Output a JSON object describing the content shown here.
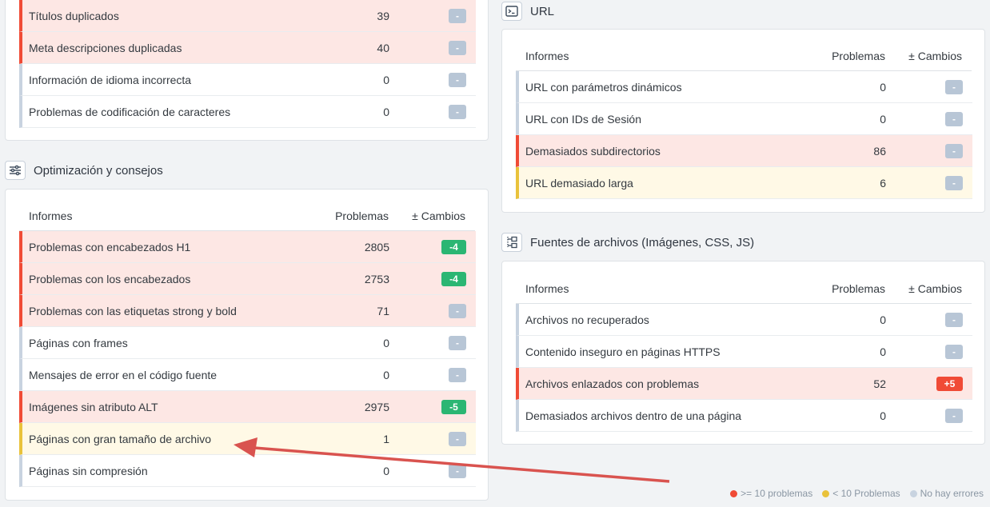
{
  "headers": {
    "reports": "Informes",
    "problems": "Problemas",
    "changes": "± Cambios"
  },
  "top_left_rows": [
    {
      "name": "Títulos duplicados",
      "count": "39",
      "change": "-",
      "level": "red",
      "badge": "neutral"
    },
    {
      "name": "Meta descripciones duplicadas",
      "count": "40",
      "change": "-",
      "level": "red",
      "badge": "neutral"
    },
    {
      "name": "Información de idioma incorrecta",
      "count": "0",
      "change": "-",
      "level": "none",
      "badge": "neutral"
    },
    {
      "name": "Problemas de codificación de caracteres",
      "count": "0",
      "change": "-",
      "level": "none",
      "badge": "neutral"
    }
  ],
  "optimization": {
    "title": "Optimización y consejos",
    "icon": "sliders-icon",
    "rows": [
      {
        "name": "Problemas con encabezados H1",
        "count": "2805",
        "change": "-4",
        "level": "red",
        "badge": "green"
      },
      {
        "name": "Problemas con los encabezados",
        "count": "2753",
        "change": "-4",
        "level": "red",
        "badge": "green"
      },
      {
        "name": "Problemas con las etiquetas strong y bold",
        "count": "71",
        "change": "-",
        "level": "red",
        "badge": "neutral"
      },
      {
        "name": "Páginas con frames",
        "count": "0",
        "change": "-",
        "level": "none",
        "badge": "neutral"
      },
      {
        "name": "Mensajes de error en el código fuente",
        "count": "0",
        "change": "-",
        "level": "none",
        "badge": "neutral"
      },
      {
        "name": "Imágenes sin atributo ALT",
        "count": "2975",
        "change": "-5",
        "level": "red",
        "badge": "green"
      },
      {
        "name": "Páginas con gran tamaño de archivo",
        "count": "1",
        "change": "-",
        "level": "yellow",
        "badge": "neutral"
      },
      {
        "name": "Páginas sin compresión",
        "count": "0",
        "change": "-",
        "level": "none",
        "badge": "neutral"
      }
    ]
  },
  "url": {
    "title": "URL",
    "icon": "terminal-icon",
    "rows": [
      {
        "name": "URL con parámetros dinámicos",
        "count": "0",
        "change": "-",
        "level": "none",
        "badge": "neutral"
      },
      {
        "name": "URL con IDs de Sesión",
        "count": "0",
        "change": "-",
        "level": "none",
        "badge": "neutral"
      },
      {
        "name": "Demasiados subdirectorios",
        "count": "86",
        "change": "-",
        "level": "red",
        "badge": "neutral"
      },
      {
        "name": "URL demasiado larga",
        "count": "6",
        "change": "-",
        "level": "yellow",
        "badge": "neutral"
      }
    ]
  },
  "files": {
    "title": "Fuentes de archivos (Imágenes, CSS, JS)",
    "icon": "file-tree-icon",
    "rows": [
      {
        "name": "Archivos no recuperados",
        "count": "0",
        "change": "-",
        "level": "none",
        "badge": "neutral"
      },
      {
        "name": "Contenido inseguro en páginas HTTPS",
        "count": "0",
        "change": "-",
        "level": "none",
        "badge": "neutral"
      },
      {
        "name": "Archivos enlazados con problemas",
        "count": "52",
        "change": "+5",
        "level": "red",
        "badge": "redb"
      },
      {
        "name": "Demasiados archivos dentro de una página",
        "count": "0",
        "change": "-",
        "level": "none",
        "badge": "neutral"
      }
    ]
  },
  "legend": {
    "red": "&gt;= 10 problemas",
    "red_text": ">= 10 problemas",
    "yellow_text": "< 10 Problemas",
    "gray_text": "No hay errores",
    "colors": {
      "red": "#f04b36",
      "yellow": "#e9c23b",
      "gray": "#c8d3e0"
    }
  }
}
